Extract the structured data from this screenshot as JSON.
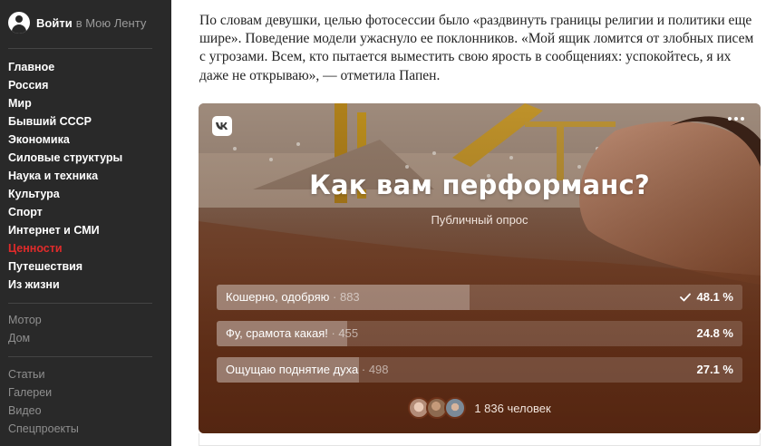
{
  "sidebar": {
    "login_label": "Войти",
    "login_suffix": "в Мою Ленту",
    "main_items": [
      "Главное",
      "Россия",
      "Мир",
      "Бывший СССР",
      "Экономика",
      "Силовые структуры",
      "Наука и техника",
      "Культура",
      "Спорт",
      "Интернет и СМИ",
      "Ценности",
      "Путешествия",
      "Из жизни"
    ],
    "active_item": "Ценности",
    "active_color": "#e02b2b",
    "secondary_items": [
      "Мотор",
      "Дом"
    ],
    "tertiary_items": [
      "Статьи",
      "Галереи",
      "Видео",
      "Спецпроекты"
    ]
  },
  "article": {
    "paragraph": "По словам девушки, целью фотосессии было «раздвинуть границы религии и политики еще шире». Поведение модели ужаснуло ее поклонников. «Мой ящик ломится от злобных писем с угрозами. Всем, кто пытается выместить свою ярость в сообщениях: успокойтесь, я их даже не открываю», — отметила Папен."
  },
  "poll": {
    "brand_icon": "vk-logo-icon",
    "title": "Как вам перформанс?",
    "subtitle": "Публичный опрос",
    "answers": [
      {
        "label": "Кошерно, одобряю",
        "count": "883",
        "percent": "48.1 %",
        "fraction": 0.481,
        "selected": true
      },
      {
        "label": "Фу, срамота какая!",
        "count": "455",
        "percent": "24.8 %",
        "fraction": 0.248,
        "selected": false
      },
      {
        "label": "Ощущаю поднятие духа",
        "count": "498",
        "percent": "27.1 %",
        "fraction": 0.271,
        "selected": false
      }
    ],
    "voters": "1 836 человек"
  }
}
